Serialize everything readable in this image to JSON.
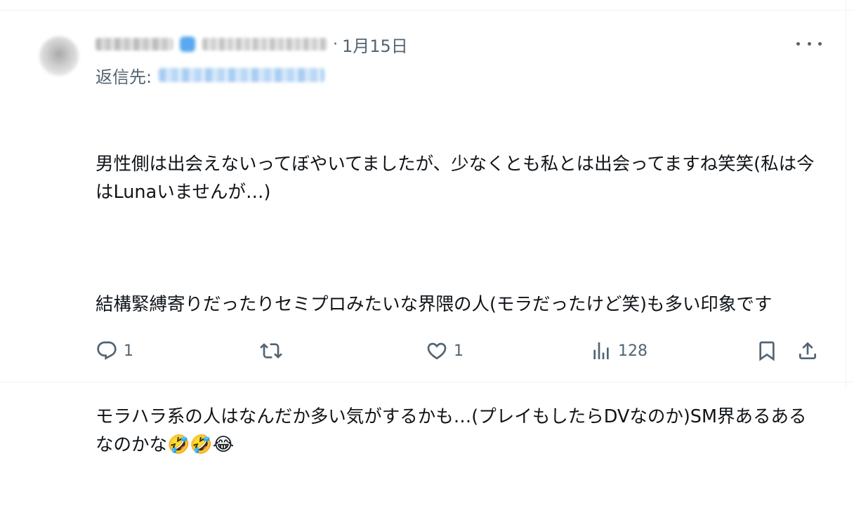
{
  "post": {
    "date": "1月15日",
    "separator": "·",
    "reply_prefix": "返信先:",
    "paragraphs": [
      "男性側は出会えないってぼやいてましたが、少なくとも私とは出会ってますね笑笑(私は今はLunaいませんが…)",
      "結構緊縛寄りだったりセミプロみたいな界隈の人(モラだったけど笑)も多い印象です",
      "モラハラ系の人はなんだか多い気がするかも…(プレイもしたらDVなのか)SM界あるあるなのかな"
    ],
    "trailing_emoji": "🤣🤣😂"
  },
  "actions": {
    "reply_count": "1",
    "repost_count": "",
    "like_count": "1",
    "views_count": "128"
  },
  "icons": {
    "reply": "reply-icon",
    "repost": "repost-icon",
    "like": "heart-icon",
    "views": "views-icon",
    "bookmark": "bookmark-icon",
    "share": "share-icon",
    "more": "more-icon"
  },
  "colors": {
    "text": "#0f1419",
    "secondary": "#536471",
    "divider": "#eff3f4"
  }
}
